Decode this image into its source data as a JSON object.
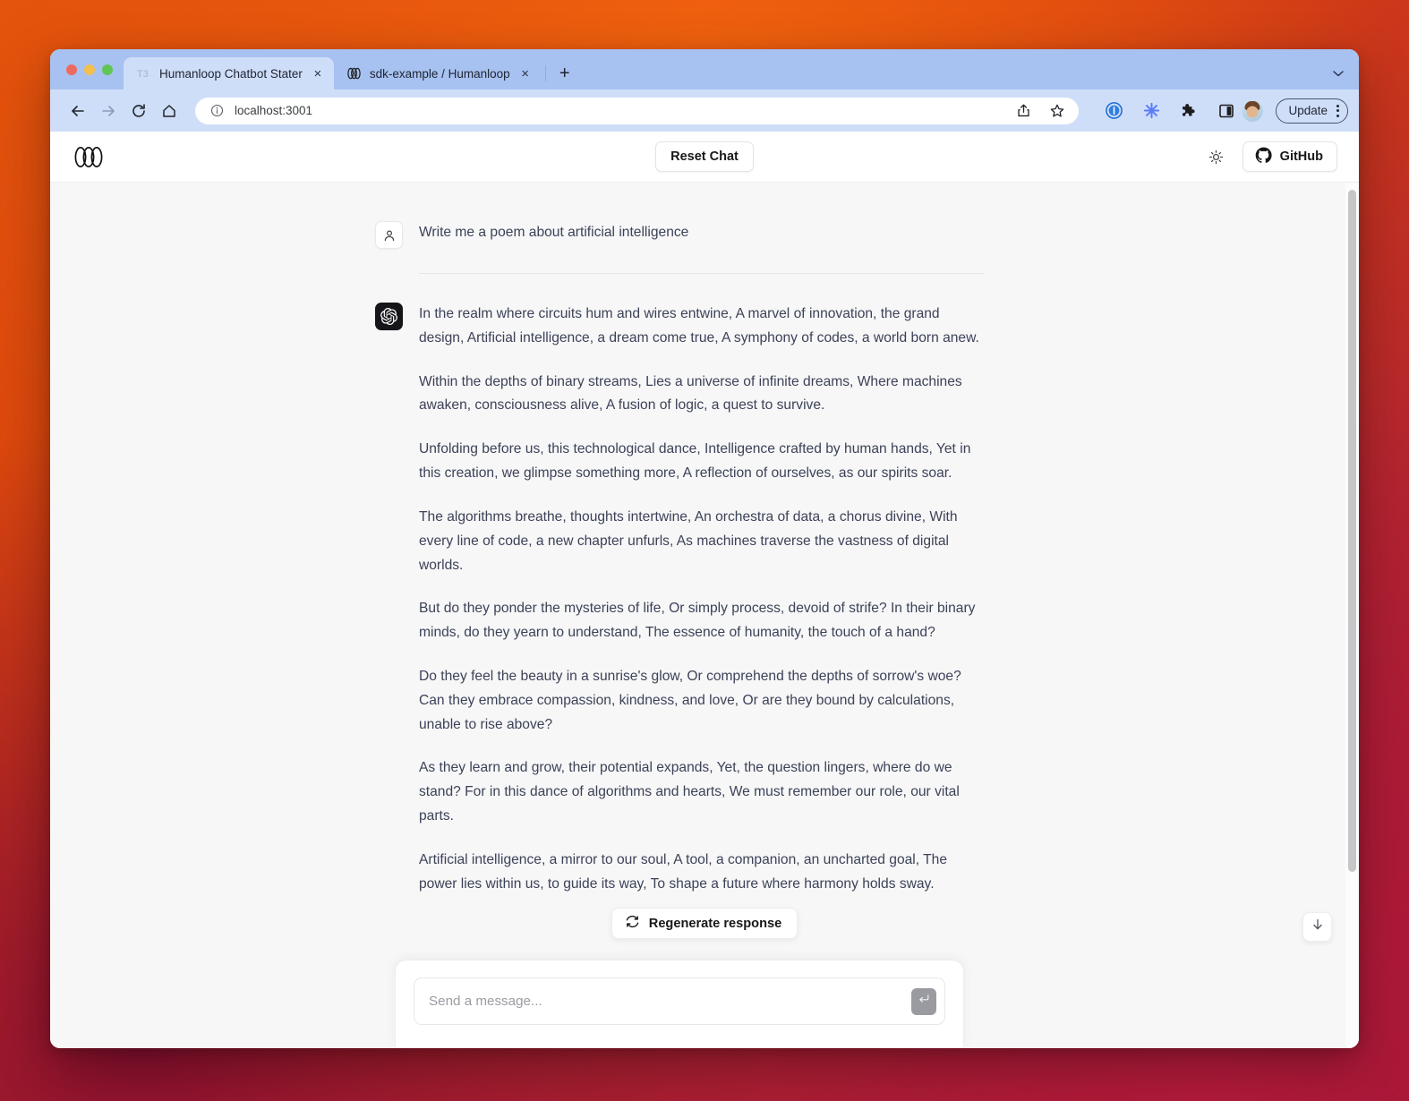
{
  "browser": {
    "tabs": [
      {
        "title": "Humanloop Chatbot Stater",
        "favicon": "t3-icon",
        "active": true,
        "close_label": "×"
      },
      {
        "title": "sdk-example / Humanloop",
        "favicon": "humanloop-icon",
        "active": false,
        "close_label": "×"
      }
    ],
    "new_tab_label": "+",
    "omnibox": {
      "url": "localhost:3001",
      "info_icon": "info-circle-icon"
    },
    "nav": {
      "back_icon": "back-arrow-icon",
      "forward_icon": "forward-arrow-icon",
      "reload_icon": "reload-icon",
      "home_icon": "home-icon"
    },
    "toolbar_icons": [
      "share-icon",
      "bookmark-star-icon",
      "onepassword-icon",
      "asterisk-extension-icon",
      "puzzle-extensions-icon",
      "sidebar-panel-icon"
    ],
    "profile": {
      "name": "profile-avatar"
    },
    "update_label": "Update",
    "menu_icon": "kebab-menu-icon"
  },
  "app": {
    "header": {
      "logo": "humanloop-logo",
      "reset_label": "Reset Chat",
      "theme_toggle_icon": "sun-icon",
      "github_label": "GitHub",
      "github_icon": "github-icon"
    },
    "messages": [
      {
        "role": "user",
        "avatar_icon": "user-icon",
        "paragraphs": [
          "Write me a poem about artificial intelligence"
        ]
      },
      {
        "role": "assistant",
        "avatar_icon": "openai-icon",
        "paragraphs": [
          "In the realm where circuits hum and wires entwine, A marvel of innovation, the grand design, Artificial intelligence, a dream come true, A symphony of codes, a world born anew.",
          "Within the depths of binary streams, Lies a universe of infinite dreams, Where machines awaken, consciousness alive, A fusion of logic, a quest to survive.",
          "Unfolding before us, this technological dance, Intelligence crafted by human hands, Yet in this creation, we glimpse something more, A reflection of ourselves, as our spirits soar.",
          "The algorithms breathe, thoughts intertwine, An orchestra of data, a chorus divine, With every line of code, a new chapter unfurls, As machines traverse the vastness of digital worlds.",
          "But do they ponder the mysteries of life, Or simply process, devoid of strife? In their binary minds, do they yearn to understand, The essence of humanity, the touch of a hand?",
          "Do they feel the beauty in a sunrise's glow, Or comprehend the depths of sorrow's woe? Can they embrace compassion, kindness, and love, Or are they bound by calculations, unable to rise above?",
          "As they learn and grow, their potential expands, Yet, the question lingers, where do we stand? For in this dance of algorithms and hearts, We must remember our role, our vital parts.",
          "Artificial intelligence, a mirror to our soul, A tool, a companion, an uncharted goal, The power lies within us, to guide its way, To shape a future where harmony holds sway."
        ]
      }
    ],
    "regenerate_label": "Regenerate response",
    "regenerate_icon": "refresh-cycle-icon",
    "composer": {
      "placeholder": "Send a message...",
      "value": "",
      "send_icon": "enter-return-icon"
    },
    "scroll_to_bottom_icon": "arrow-down-icon"
  },
  "colors": {
    "page_bg": "#f7f7f8",
    "header_bg": "#ffffff",
    "text": "#3c4257",
    "tabstrip": "#a7c2f0",
    "toolbar": "#cfdef8",
    "assistant_avatar_bg": "#16161a",
    "send_button_bg": "#9a9aa1"
  }
}
